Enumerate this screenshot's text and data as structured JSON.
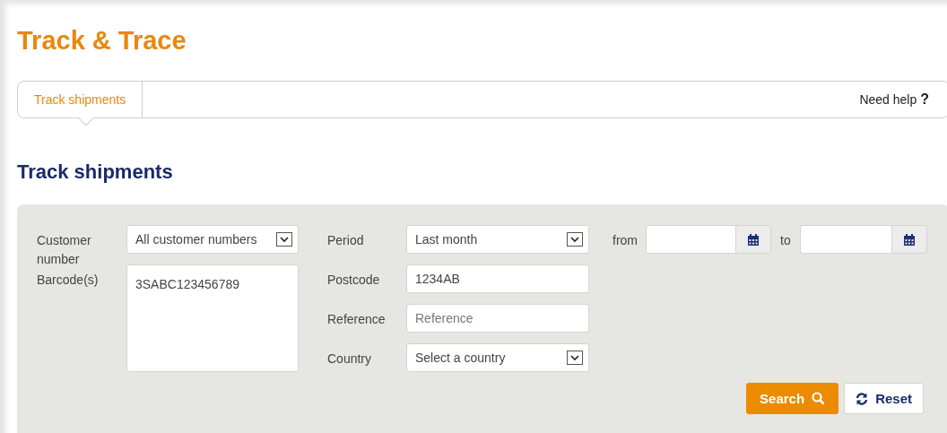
{
  "page_title": "Track & Trace",
  "tabs": [
    {
      "label": "Track shipments",
      "selected": true
    }
  ],
  "help_link": {
    "label": "Need help",
    "icon": "?"
  },
  "section_title": "Track shipments",
  "form": {
    "customer_number": {
      "label": "Customer number",
      "value": "All customer numbers"
    },
    "barcodes": {
      "label": "Barcode(s)",
      "value": "3SABC123456789"
    },
    "period": {
      "label": "Period",
      "value": "Last month"
    },
    "date_from": {
      "label": "from"
    },
    "date_to": {
      "label": "to"
    },
    "postcode": {
      "label": "Postcode",
      "value": "1234AB"
    },
    "reference": {
      "label": "Reference",
      "placeholder": "Reference"
    },
    "country": {
      "label": "Country",
      "value": "Select a country"
    }
  },
  "buttons": [
    {
      "label": "Search",
      "kind": "primary"
    },
    {
      "label": "Reset",
      "kind": "secondary"
    }
  ]
}
